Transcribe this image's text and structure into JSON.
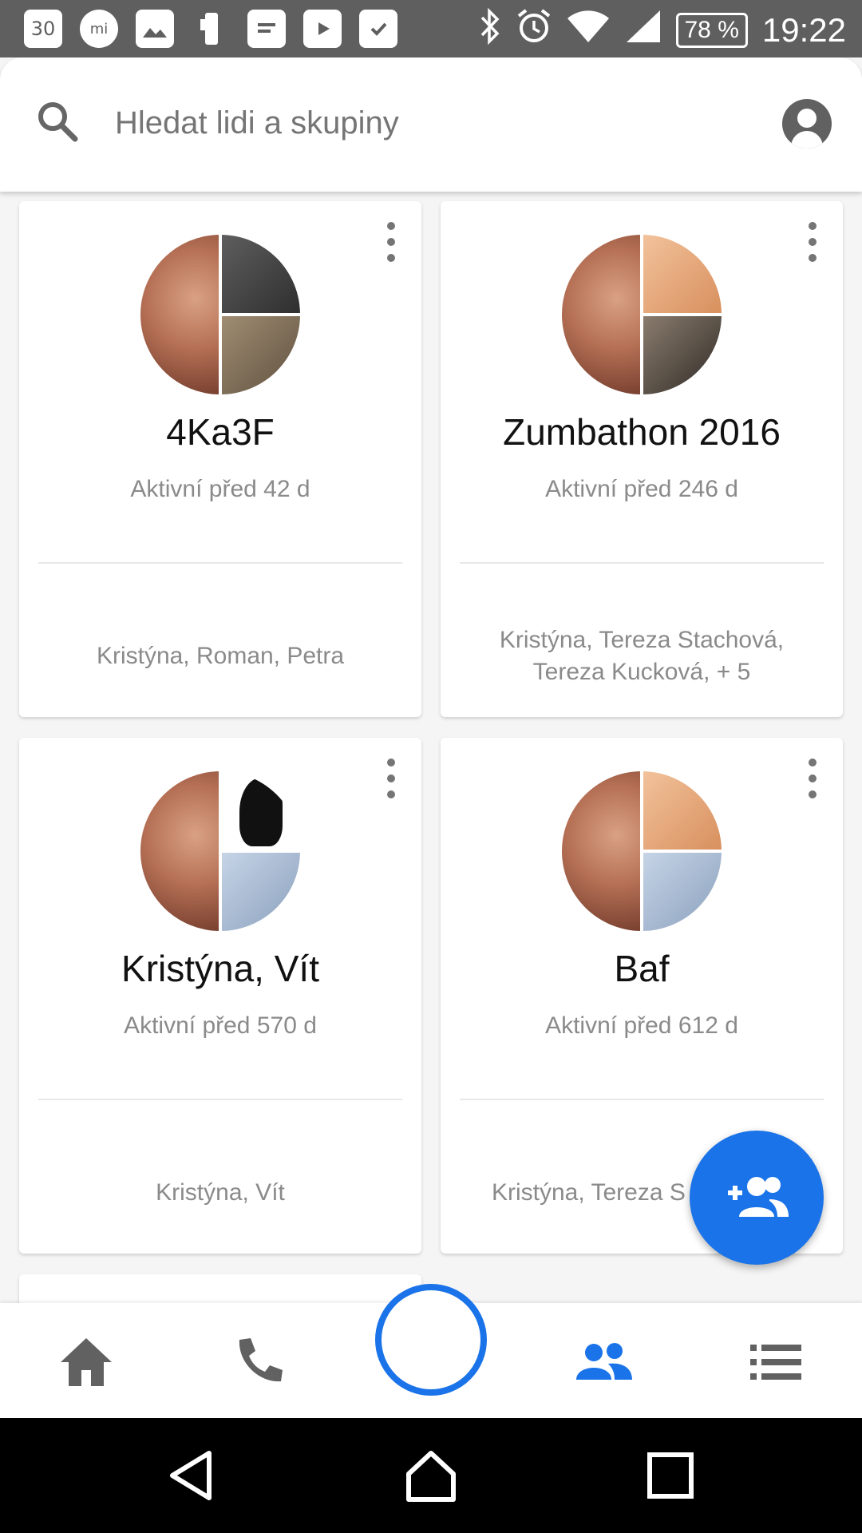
{
  "status_bar": {
    "left_icons": [
      "calendar-icon",
      "mi-icon",
      "gallery-icon",
      "phone-transfer-icon",
      "message-icon",
      "play-store-icon",
      "briefcase-check-icon"
    ],
    "calendar_day": "30",
    "mi_text": "mi",
    "battery": "78 %",
    "time": "19:22"
  },
  "search": {
    "placeholder": "Hledat lidi a skupiny"
  },
  "groups": [
    {
      "title": "4Ka3F",
      "activity": "Aktivní před 42 d",
      "members": "Kristýna, Roman, Petra"
    },
    {
      "title": "Zumbathon 2016",
      "activity": "Aktivní před 246 d",
      "members": "Kristýna, Tereza Stachová, Tereza Kucková, + 5"
    },
    {
      "title": "Kristýna, Vít",
      "activity": "Aktivní před 570 d",
      "members": "Kristýna, Vít"
    },
    {
      "title": "Baf",
      "activity": "Aktivní před 612 d",
      "members": "Kristýna, Tereza S"
    }
  ],
  "fab": {
    "icon": "add-group-icon"
  },
  "bottom_nav": {
    "items": [
      "home-icon",
      "phone-icon",
      "camera-capture-circle",
      "people-icon",
      "list-icon"
    ],
    "active": "people-icon",
    "accent_color": "#1a73e8"
  },
  "system_nav": [
    "back-icon",
    "home-outline-icon",
    "recents-icon"
  ]
}
